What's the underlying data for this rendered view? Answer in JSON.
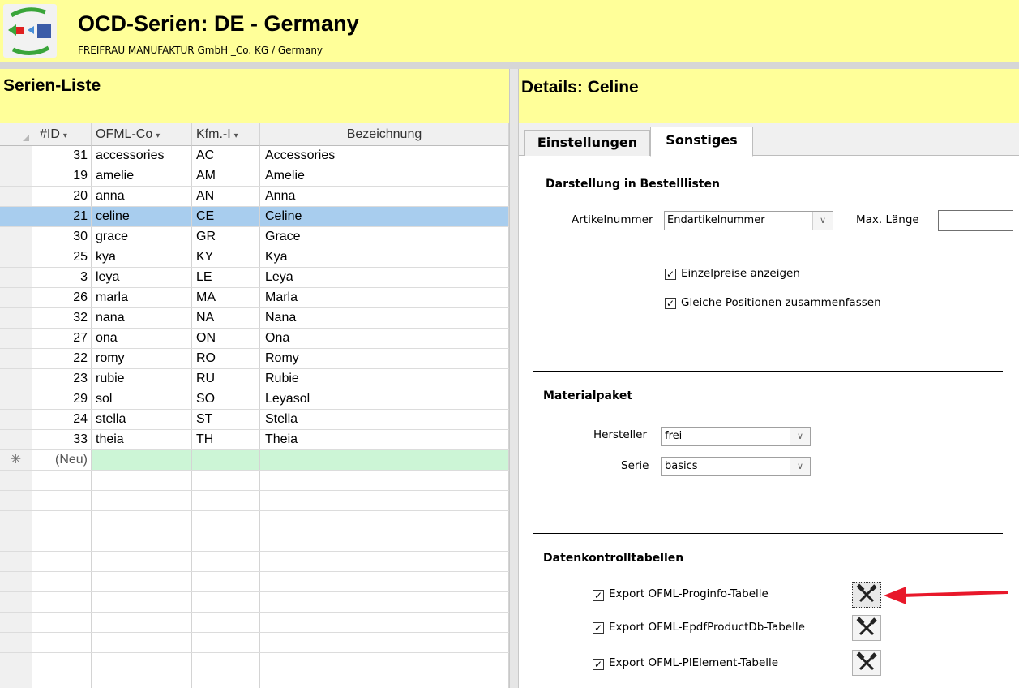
{
  "app": {
    "title": "OCD-Serien: DE - Germany",
    "subtitle": "FREIFRAU MANUFAKTUR GmbH _Co. KG / Germany",
    "logo_icon": "series-transfer-logo-icon"
  },
  "list": {
    "title": "Serien-Liste",
    "columns": [
      {
        "label": "#ID",
        "dropdown": true
      },
      {
        "label": "OFML-Co",
        "dropdown": true
      },
      {
        "label": "Kfm.-I",
        "dropdown": true
      },
      {
        "label": "Bezeichnung",
        "dropdown": false
      }
    ],
    "rows": [
      {
        "id": "31",
        "code": "accessories",
        "kfm": "AC",
        "name": "Accessories",
        "selected": false
      },
      {
        "id": "19",
        "code": "amelie",
        "kfm": "AM",
        "name": "Amelie",
        "selected": false
      },
      {
        "id": "20",
        "code": "anna",
        "kfm": "AN",
        "name": "Anna",
        "selected": false
      },
      {
        "id": "21",
        "code": "celine",
        "kfm": "CE",
        "name": "Celine",
        "selected": true
      },
      {
        "id": "30",
        "code": "grace",
        "kfm": "GR",
        "name": "Grace",
        "selected": false
      },
      {
        "id": "25",
        "code": "kya",
        "kfm": "KY",
        "name": "Kya",
        "selected": false
      },
      {
        "id": "3",
        "code": "leya",
        "kfm": "LE",
        "name": "Leya",
        "selected": false
      },
      {
        "id": "26",
        "code": "marla",
        "kfm": "MA",
        "name": "Marla",
        "selected": false
      },
      {
        "id": "32",
        "code": "nana",
        "kfm": "NA",
        "name": "Nana",
        "selected": false
      },
      {
        "id": "27",
        "code": "ona",
        "kfm": "ON",
        "name": "Ona",
        "selected": false
      },
      {
        "id": "22",
        "code": "romy",
        "kfm": "RO",
        "name": "Romy",
        "selected": false
      },
      {
        "id": "23",
        "code": "rubie",
        "kfm": "RU",
        "name": "Rubie",
        "selected": false
      },
      {
        "id": "29",
        "code": "sol",
        "kfm": "SO",
        "name": "Leyasol",
        "selected": false
      },
      {
        "id": "24",
        "code": "stella",
        "kfm": "ST",
        "name": "Stella",
        "selected": false
      },
      {
        "id": "33",
        "code": "theia",
        "kfm": "TH",
        "name": "Theia",
        "selected": false
      }
    ],
    "new_row": {
      "marker": "✳",
      "id": "(Neu)"
    }
  },
  "details": {
    "title": "Details: Celine",
    "tabs": [
      {
        "label": "Einstellungen",
        "active": false
      },
      {
        "label": "Sonstiges",
        "active": true
      }
    ],
    "bestelllisten": {
      "title": "Darstellung in Bestelllisten",
      "artikelnummer_label": "Artikelnummer",
      "artikelnummer_value": "Endartikelnummer",
      "max_laenge_label": "Max. Länge",
      "max_laenge_value": "",
      "einzelpreise_label": "Einzelpreise anzeigen",
      "einzelpreise_checked": true,
      "gleiche_label": "Gleiche Positionen zusammenfassen",
      "gleiche_checked": true
    },
    "materialpaket": {
      "title": "Materialpaket",
      "hersteller_label": "Hersteller",
      "hersteller_value": "frei",
      "serie_label": "Serie",
      "serie_value": "basics"
    },
    "datenkontroll": {
      "title": "Datenkontrolltabellen",
      "exports": [
        {
          "label": "Export OFML-Proginfo-Tabelle",
          "checked": true,
          "icon": "tools-icon",
          "focused": true
        },
        {
          "label": "Export OFML-EpdfProductDb-Tabelle",
          "checked": true,
          "icon": "tools-icon",
          "focused": false
        },
        {
          "label": "Export OFML-PlElement-Tabelle",
          "checked": true,
          "icon": "tools-icon",
          "focused": false
        }
      ]
    }
  },
  "colors": {
    "header_bg": "#ffff99",
    "selected_row": "#a8cdee",
    "new_row": "#ccf5d6",
    "annotation_arrow": "#e8182a"
  }
}
